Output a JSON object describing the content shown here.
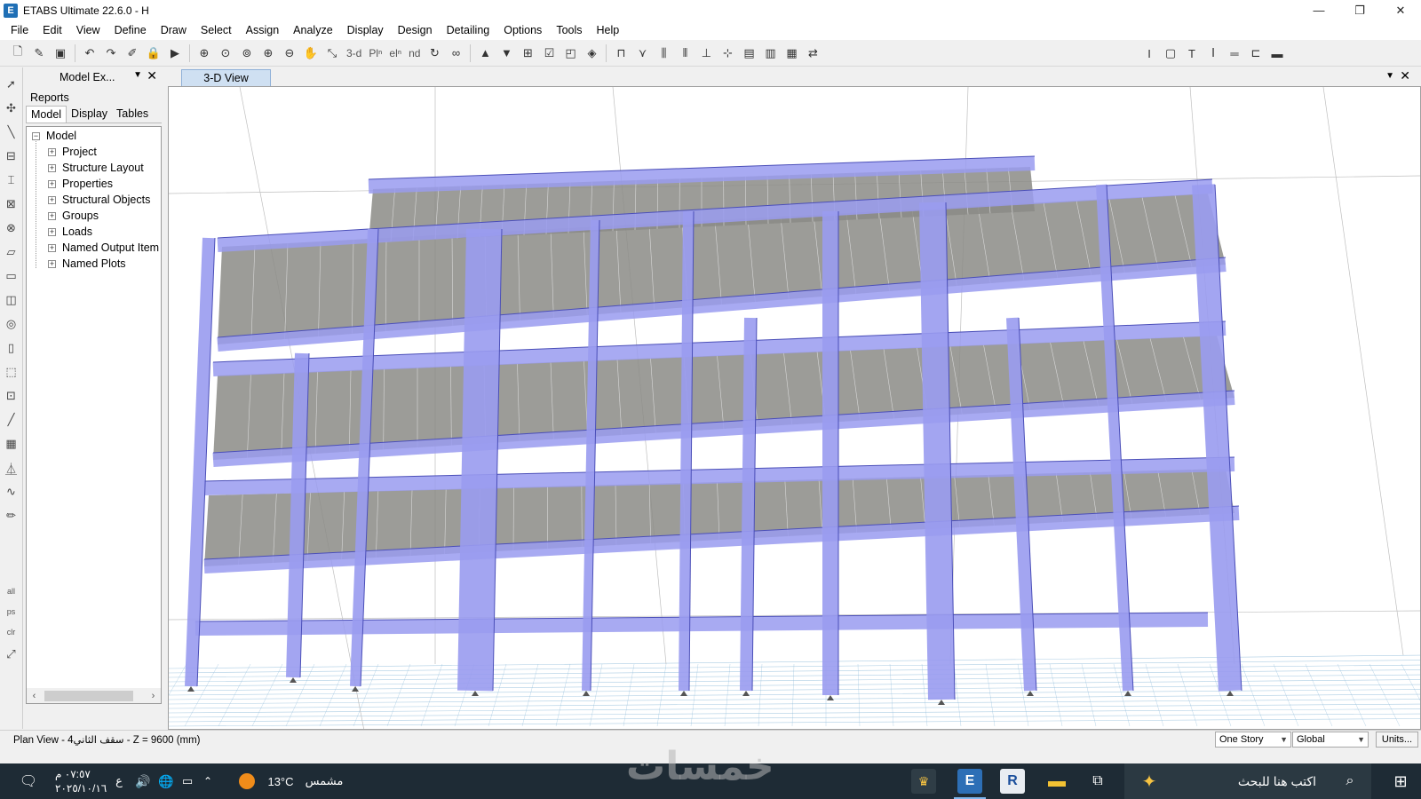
{
  "window": {
    "title": "ETABS Ultimate 22.6.0 - H",
    "app_icon": "E",
    "minimize": "—",
    "restore": "❐",
    "close": "✕"
  },
  "menu": [
    "File",
    "Edit",
    "View",
    "Define",
    "Draw",
    "Select",
    "Assign",
    "Analyze",
    "Display",
    "Design",
    "Detailing",
    "Options",
    "Tools",
    "Help"
  ],
  "toolbar": {
    "view_3d_label": "3-d",
    "plan_label": "Plⁿ",
    "elev_label": "elⁿ",
    "nd_label": "nd"
  },
  "left_toolbar": {
    "all_label": "all",
    "ps_label": "ps",
    "clr_label": "clr"
  },
  "panel": {
    "title": "Model Ex...",
    "tabs_top": [
      "Reports"
    ],
    "tabs": [
      "Model",
      "Display",
      "Tables"
    ],
    "tree_root": "Model",
    "tree_items": [
      "Project",
      "Structure Layout",
      "Properties",
      "Structural Objects",
      "Groups",
      "Loads",
      "Named Output Item",
      "Named Plots"
    ]
  },
  "document": {
    "tab_title": "3-D View"
  },
  "status": {
    "view_text": "Plan View - 4سقف الثاني - Z = 9600 (mm)",
    "story_combo": "One Story",
    "coord_combo": "Global",
    "units_button": "Units..."
  },
  "taskbar": {
    "time": "٠٧:٥٧ م",
    "date": "٢٠٢٥/١٠/١٦",
    "lang": "ع",
    "temperature": "13°C",
    "weather": "مشمس",
    "search_placeholder": "اكتب هنا للبحث",
    "etabs_tile": "E",
    "revit_tile": "R"
  },
  "watermark": "خمسات",
  "colors": {
    "frame_fill": "#9a9cf0",
    "frame_stroke": "#4b4fb8",
    "slab_fill": "#8b8b86",
    "grid_line": "#8ab8d8",
    "taskbar": "#1e2b35"
  }
}
